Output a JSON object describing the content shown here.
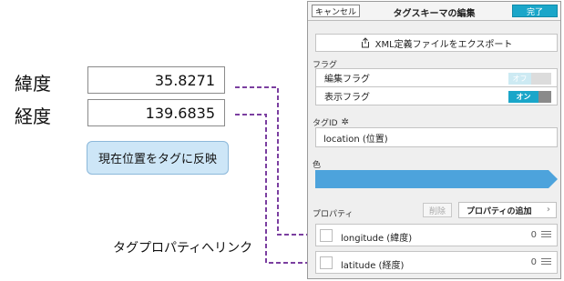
{
  "left": {
    "latitude_label": "緯度",
    "latitude_value": "35.8271",
    "longitude_label": "経度",
    "longitude_value": "139.6835",
    "reflect_button": "現在位置をタグに反映",
    "link_caption": "タグプロパティへリンク"
  },
  "panel": {
    "cancel": "キャンセル",
    "title": "タグスキーマの編集",
    "done": "完了",
    "export": "XML定義ファイルをエクスポート",
    "flags_section": "フラグ",
    "flags": [
      {
        "label": "編集フラグ",
        "toggle": "オフ",
        "state": "off"
      },
      {
        "label": "表示フラグ",
        "toggle": "オン",
        "state": "on"
      }
    ],
    "tagid_section": "タグID",
    "tagid_value": "location (位置)",
    "color_section": "色",
    "color_value": "#4da3dc",
    "properties_section": "プロパティ",
    "delete_button": "削除",
    "add_property_button": "プロパティの追加",
    "properties": [
      {
        "name": "longitude (緯度)",
        "count": "0"
      },
      {
        "name": "latitude (経度)",
        "count": "0"
      }
    ]
  },
  "colors": {
    "accent": "#1aa6c9",
    "link_line": "#7b3fa0",
    "button_bg": "#cde6f7"
  }
}
